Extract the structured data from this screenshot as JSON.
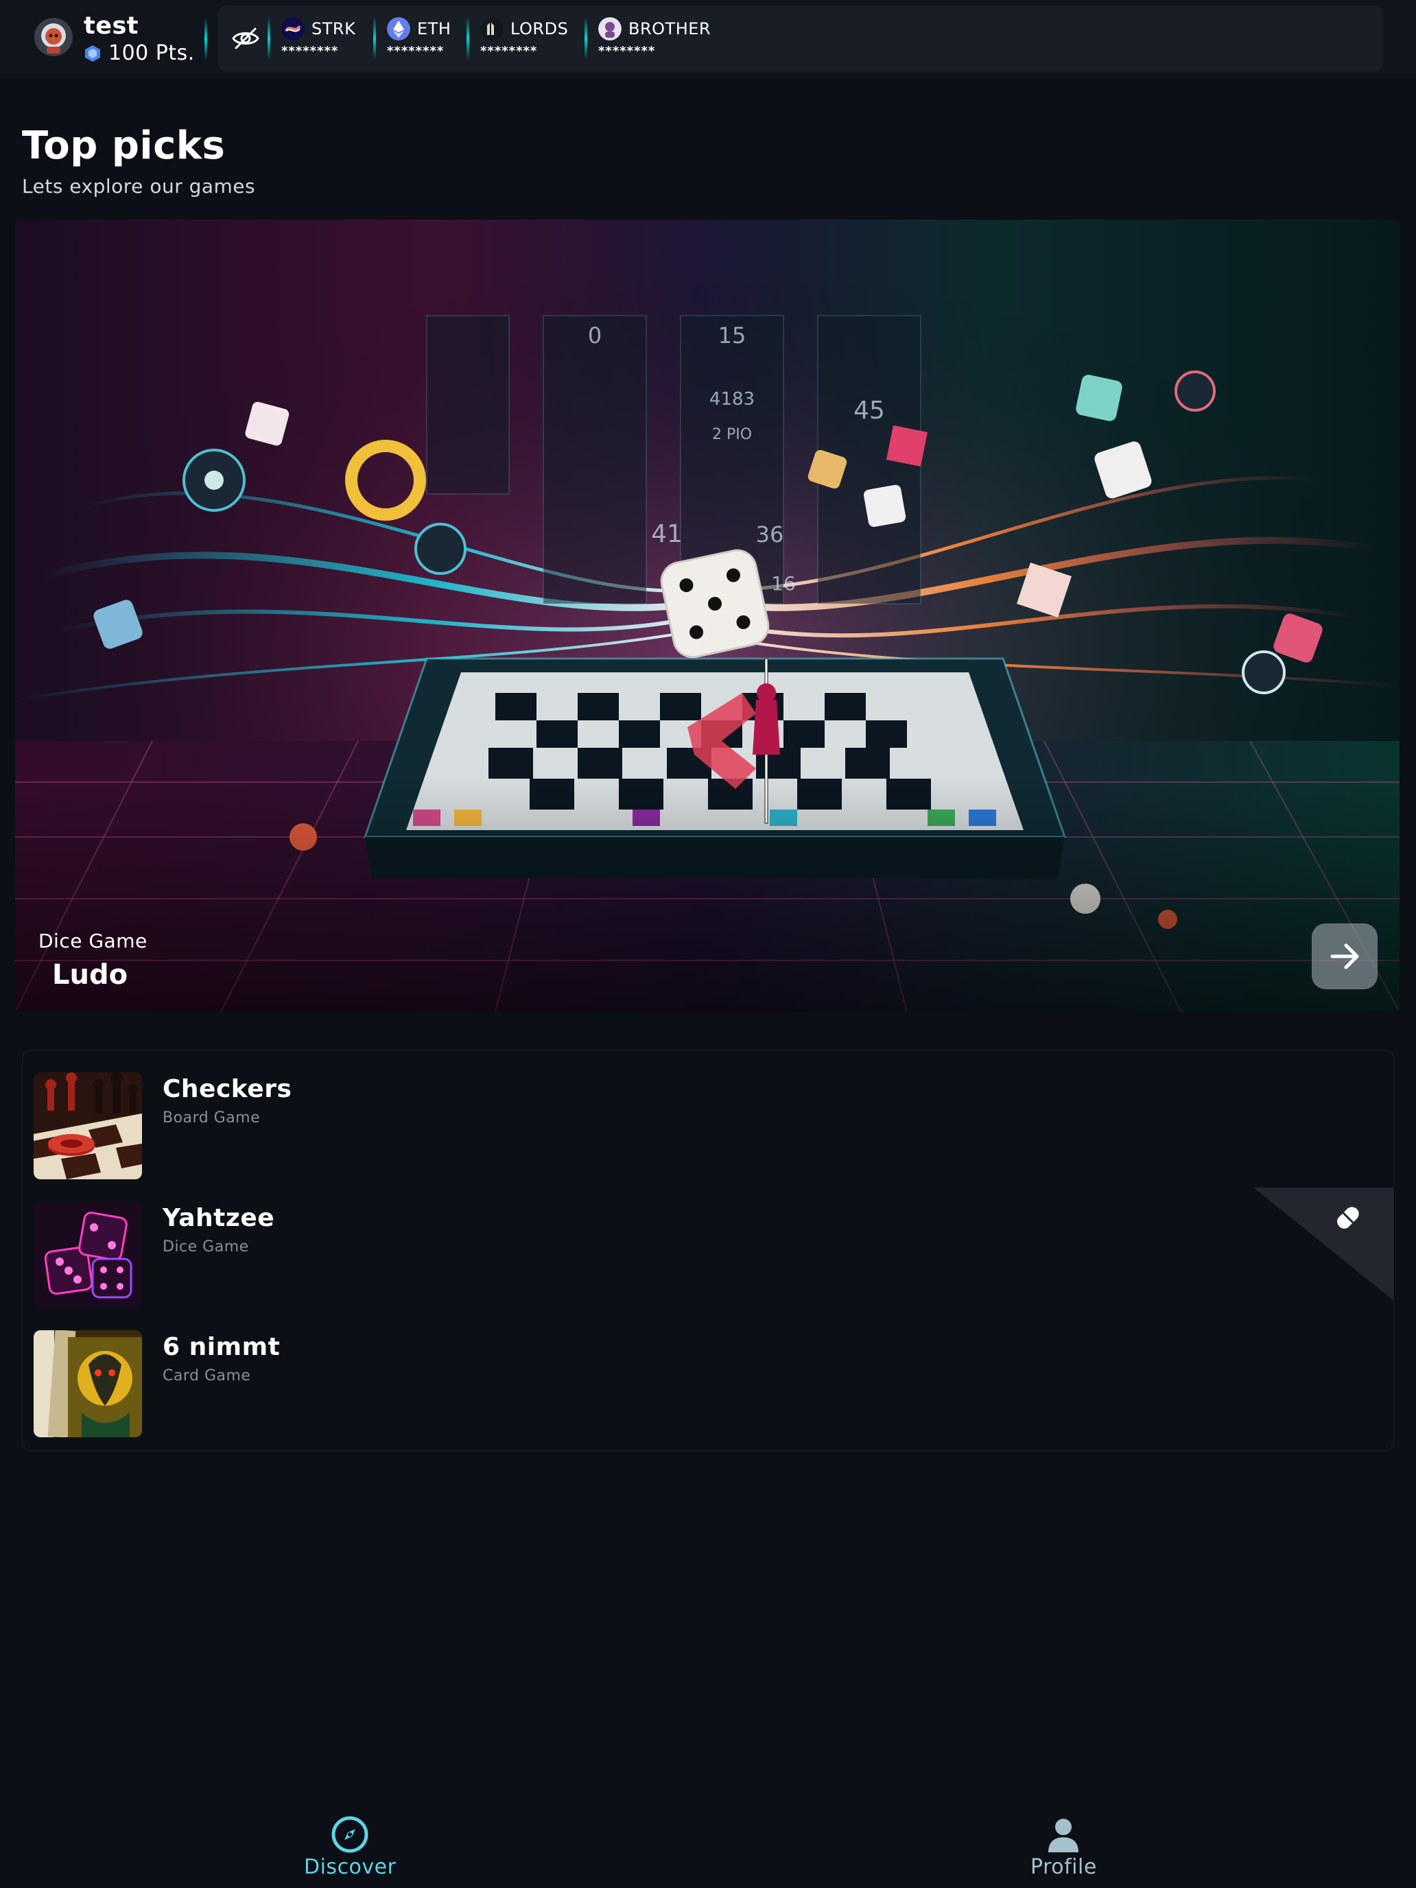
{
  "user": {
    "name": "test",
    "points": "100 Pts."
  },
  "wallet": {
    "tokens": [
      {
        "name": "STRK",
        "balance": "********",
        "icon": "strk-icon"
      },
      {
        "name": "ETH",
        "balance": "********",
        "icon": "eth-icon"
      },
      {
        "name": "LORDS",
        "balance": "********",
        "icon": "lords-icon"
      },
      {
        "name": "BROTHER",
        "balance": "********",
        "icon": "brother-icon"
      }
    ]
  },
  "page": {
    "title": "Top picks",
    "subtitle": "Lets explore our games"
  },
  "featured": {
    "category": "Dice Game",
    "name": "Ludo"
  },
  "games": [
    {
      "name": "Checkers",
      "category": "Board Game"
    },
    {
      "name": "Yahtzee",
      "category": "Dice Game"
    },
    {
      "name": "6 nimmt",
      "category": "Card Game"
    }
  ],
  "nav": {
    "discover": "Discover",
    "profile": "Profile"
  },
  "colors": {
    "background": "#0c0f15",
    "accent_teal": "#00d4d4",
    "discover_active": "#5fd3e6",
    "profile_inactive": "#a6c0cc"
  }
}
